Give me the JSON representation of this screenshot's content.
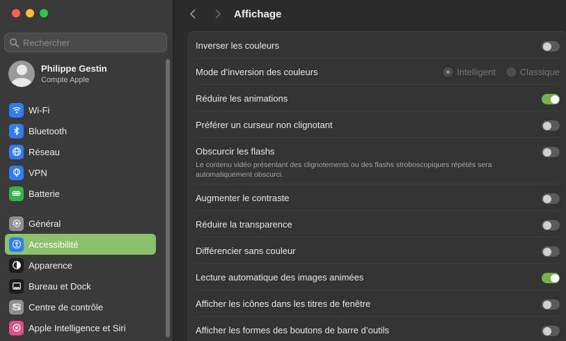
{
  "sidebar": {
    "search_placeholder": "Rechercher",
    "profile": {
      "name": "Philippe Gestin",
      "subtitle": "Compte Apple"
    },
    "items_group1": [
      {
        "label": "Wi-Fi",
        "icon": "wifi-icon",
        "color": "#2f7cf6"
      },
      {
        "label": "Bluetooth",
        "icon": "bluetooth-icon",
        "color": "#2f7cf6"
      },
      {
        "label": "Réseau",
        "icon": "globe-icon",
        "color": "#2f7cf6"
      },
      {
        "label": "VPN",
        "icon": "vpn-globe-icon",
        "color": "#2f7cf6"
      },
      {
        "label": "Batterie",
        "icon": "battery-icon",
        "color": "#36b34a"
      }
    ],
    "items_group2": [
      {
        "label": "Général",
        "icon": "gear-icon",
        "color": "#8e8e93"
      },
      {
        "label": "Accessibilité",
        "icon": "accessibility-icon",
        "color": "#2f7cf6",
        "active": true
      },
      {
        "label": "Apparence",
        "icon": "appearance-icon",
        "color": "#1c1c1c"
      },
      {
        "label": "Bureau et Dock",
        "icon": "dock-icon",
        "color": "#1c1c1c"
      },
      {
        "label": "Centre de contrôle",
        "icon": "control-center-icon",
        "color": "#8e8e93"
      },
      {
        "label": "Apple Intelligence et Siri",
        "icon": "siri-icon",
        "color": "#e0508a"
      }
    ],
    "active_color": "#8bc16a"
  },
  "main": {
    "title": "Affichage",
    "rows": [
      {
        "label": "Inverser les couleurs",
        "type": "toggle",
        "on": false
      },
      {
        "label": "Mode d’inversion des couleurs",
        "type": "radio",
        "options": [
          "Intelligent",
          "Classique"
        ],
        "selected": "Intelligent",
        "disabled": true
      },
      {
        "label": "Réduire les animations",
        "type": "toggle",
        "on": true
      },
      {
        "label": "Préférer un curseur non clignotant",
        "type": "toggle",
        "on": false
      },
      {
        "label": "Obscurcir les flashs",
        "type": "toggle",
        "on": false,
        "description": "Le contenu vidéo présentant des clignotements ou des flashs stroboscopiques répétés sera automatiquement obscurci."
      },
      {
        "label": "Augmenter le contraste",
        "type": "toggle",
        "on": false
      },
      {
        "label": "Réduire la transparence",
        "type": "toggle",
        "on": false
      },
      {
        "label": "Différencier sans couleur",
        "type": "toggle",
        "on": false
      },
      {
        "label": "Lecture automatique des images animées",
        "type": "toggle",
        "on": true
      },
      {
        "label": "Afficher les icônes dans les titres de fenêtre",
        "type": "toggle",
        "on": false
      },
      {
        "label": "Afficher les formes des boutons de barre d’outils",
        "type": "toggle",
        "on": false
      }
    ],
    "toggle_on_color": "#76b14f"
  }
}
